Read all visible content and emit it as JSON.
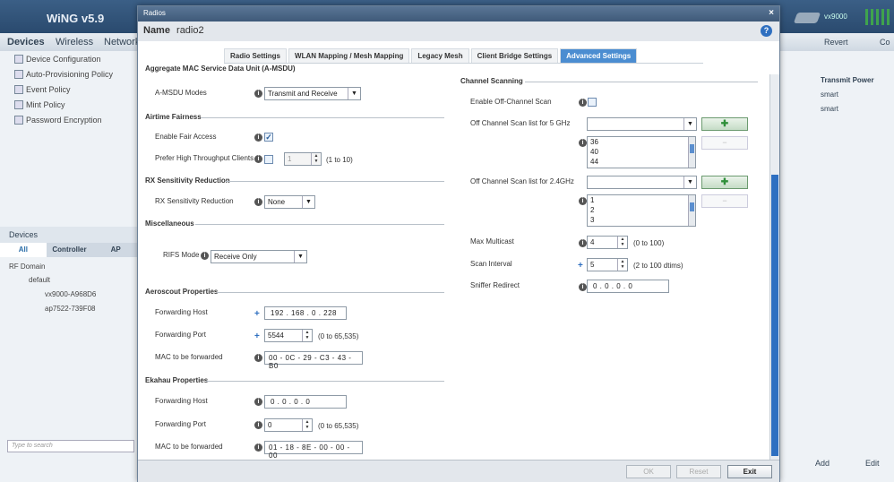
{
  "app": {
    "logo": "WiNG v5.9",
    "device_model": "vx9000",
    "nav": [
      "Devices",
      "Wireless",
      "Network"
    ],
    "left_menu": [
      "Device Configuration",
      "Auto-Provisioning Policy",
      "Event Policy",
      "Mint Policy",
      "Password Encryption"
    ],
    "devices_header": "Devices",
    "device_tabs": [
      "All",
      "Controller",
      "AP"
    ],
    "tree": {
      "rf_domain": "RF Domain",
      "default": "default",
      "vx": "vx9000-A968D6",
      "ap": "ap7522-739F08"
    },
    "search_placeholder": "Type to search",
    "right": {
      "revert": "Revert",
      "commit": "Co",
      "col_header": "Transmit Power",
      "rows": [
        "smart",
        "smart"
      ],
      "add": "Add",
      "edit": "Edit"
    }
  },
  "dialog": {
    "title": "Radios",
    "name_label": "Name",
    "name_value": "radio2",
    "close": "×",
    "help": "?",
    "tabs": [
      "Radio Settings",
      "WLAN Mapping / Mesh Mapping",
      "Legacy Mesh",
      "Client Bridge Settings",
      "Advanced Settings"
    ],
    "active_tab": "Advanced Settings",
    "left": {
      "amsdu_section": "Aggregate MAC Service Data Unit (A-MSDU)",
      "amsdu_modes_label": "A-MSDU Modes",
      "amsdu_modes_value": "Transmit and Receive",
      "airtime_section": "Airtime Fairness",
      "fair_access_label": "Enable Fair Access",
      "fair_access_checked": true,
      "prefer_label": "Prefer High Throughput Clients",
      "prefer_value": "1",
      "prefer_hint": "(1 to 10)",
      "rx_section": "RX Sensitivity Reduction",
      "rx_label": "RX Sensitivity Reduction",
      "rx_value": "None",
      "misc_section": "Miscellaneous",
      "rifs_label": "RIFS Mode",
      "rifs_value": "Receive Only",
      "aero_section": "Aeroscout Properties",
      "aero_host_label": "Forwarding Host",
      "aero_host_value": "192 .  168 .   0  .  228",
      "aero_port_label": "Forwarding Port",
      "aero_port_value": "5544",
      "port_hint": "(0 to 65,535)",
      "aero_mac_label": "MAC to be forwarded",
      "aero_mac_value": "00 - 0C - 29 - C3 - 43 - B0",
      "ekahau_section": "Ekahau Properties",
      "ek_host_label": "Forwarding Host",
      "ek_host_value": "0  .   0  .   0  .   0",
      "ek_port_label": "Forwarding Port",
      "ek_port_value": "0",
      "ek_mac_label": "MAC to be forwarded",
      "ek_mac_value": "01 - 18 - 8E - 00 - 00 - 00"
    },
    "right": {
      "scan_section": "Channel Scanning",
      "offchan_label": "Enable Off-Channel Scan",
      "scan5_label": "Off Channel Scan list for 5 GHz",
      "scan5_items": [
        "36",
        "40",
        "44"
      ],
      "scan24_label": "Off Channel Scan list for 2.4GHz",
      "scan24_items": [
        "1",
        "2",
        "3"
      ],
      "multicast_label": "Max Multicast",
      "multicast_value": "4",
      "multicast_hint": "(0 to 100)",
      "scan_interval_label": "Scan Interval",
      "scan_interval_value": "5",
      "scan_interval_hint": "(2 to 100 dtims)",
      "sniffer_label": "Sniffer Redirect",
      "sniffer_value": "0  .   0  .   0  .   0"
    },
    "footer": {
      "ok": "OK",
      "reset": "Reset",
      "exit": "Exit"
    }
  }
}
